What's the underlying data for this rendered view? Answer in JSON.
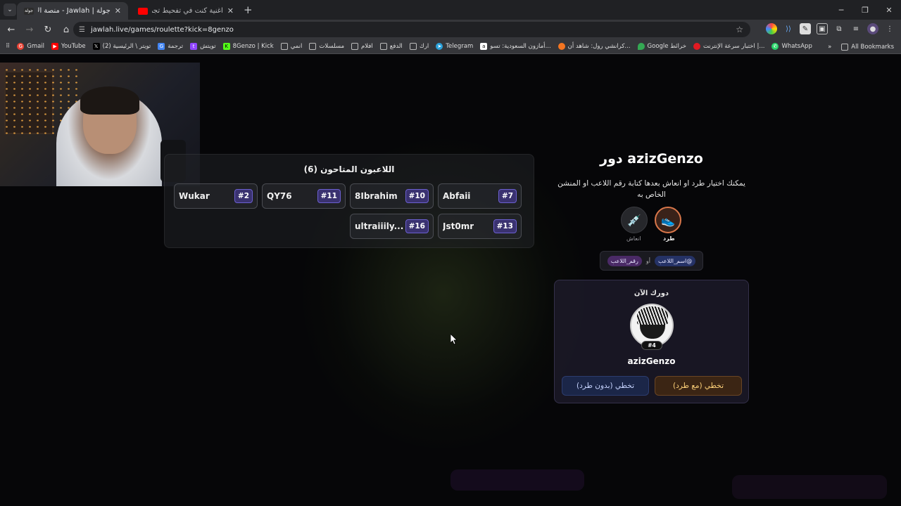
{
  "browser": {
    "tabs": [
      {
        "title": "جولة | Jawlah - منصة الألعاب الا...",
        "active": true
      },
      {
        "title": "اغنية كنت في تفحيط تجما | بدون",
        "active": false
      }
    ],
    "url": "jawlah.live/games/roulette?kick=8genzo",
    "bookmarks": [
      {
        "label": "Gmail",
        "color": "#ea4335"
      },
      {
        "label": "YouTube",
        "color": "#ff0000"
      },
      {
        "label": "(2) تويتر \\ الرئيسية",
        "color": "#000000"
      },
      {
        "label": "ترجمة",
        "color": "#4285f4"
      },
      {
        "label": "تويتش",
        "color": "#9146ff"
      },
      {
        "label": "8Genzo | Kick",
        "color": "#53fc18"
      },
      {
        "label": "انمي",
        "color": "folder"
      },
      {
        "label": "مسلسلات",
        "color": "folder"
      },
      {
        "label": "افلام",
        "color": "folder"
      },
      {
        "label": "الدفع",
        "color": "folder"
      },
      {
        "label": "ارك",
        "color": "folder"
      },
      {
        "label": "Telegram",
        "color": "#2aa1da"
      },
      {
        "label": "أمازون السعودية: تسو...",
        "color": "#ff9900"
      },
      {
        "label": "كرانشي رول: شاهد أن...",
        "color": "#f47521"
      },
      {
        "label": "Google خرائط",
        "color": "#34a853"
      },
      {
        "label": "اختبار سرعة الإنترنت |...",
        "color": "#e21a22"
      },
      {
        "label": "WhatsApp",
        "color": "#25d366"
      }
    ],
    "all_bookmarks": "All Bookmarks"
  },
  "players_panel": {
    "title": "اللاعبون المتاحون (6)",
    "players": [
      {
        "name": "Abfaii",
        "num": "#7"
      },
      {
        "name": "8Ibrahim",
        "num": "#10"
      },
      {
        "name": "QY76",
        "num": "#11"
      },
      {
        "name": "Wukar",
        "num": "#2"
      },
      {
        "name": "Jst0mr",
        "num": "#13"
      },
      {
        "name": "ultraiiily...",
        "num": "#16"
      }
    ]
  },
  "turn": {
    "title": "دور azizGenzo",
    "description": "يمكنك اختيار طرد او انعاش بعدها كتابة رقم اللاعب او المنشن الخاص به",
    "kick_label": "طرد",
    "revive_label": "انعاش",
    "chip_name": "@اسم_اللاعب",
    "chip_or": "أو",
    "chip_number": "رقم_اللاعب",
    "now_label": "دورك الآن",
    "player_name": "azizGenzo",
    "player_badge": "#4",
    "skip_with_kick": "تخطي (مع طرد)",
    "skip_without_kick": "تخطي (بدون طرد)"
  }
}
